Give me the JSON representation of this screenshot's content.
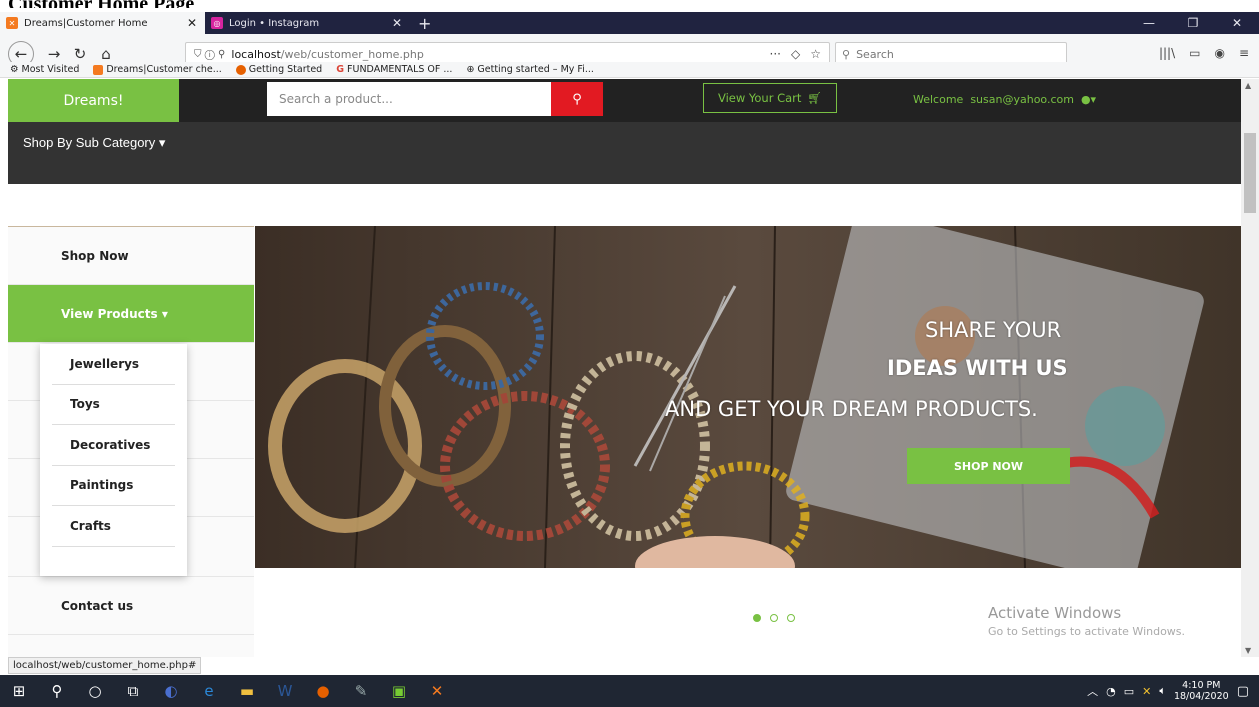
{
  "caption": "Customer Home Page",
  "browser": {
    "tabs": [
      {
        "label": "Dreams|Customer Home",
        "active": true,
        "color": "#f47a20"
      },
      {
        "label": "Login • Instagram",
        "active": false,
        "color": "#d6249f"
      }
    ],
    "url_host": "localhost",
    "url_path": "/web/customer_home.php",
    "search_placeholder": "Search",
    "bookmarks": [
      {
        "label": "Most Visited",
        "icon": "gear-icon"
      },
      {
        "label": "Dreams|Customer che...",
        "icon": "xampp-icon"
      },
      {
        "label": "Getting Started",
        "icon": "firefox-icon"
      },
      {
        "label": "FUNDAMENTALS OF ...",
        "icon": "google-icon"
      },
      {
        "label": "Getting started – My Fi...",
        "icon": "globe-icon"
      }
    ],
    "status_url": "localhost/web/customer_home.php#"
  },
  "site": {
    "logo": "Dreams!",
    "search_placeholder": "Search a product...",
    "cart_label": "View Your Cart",
    "welcome_prefix": "Welcome",
    "user_email": "susan@yahoo.com",
    "subcategory_label": "Shop By Sub Category ▾",
    "sidebar": {
      "shop_now": "Shop Now",
      "view_products": "View Products ▾",
      "contact": "Contact us"
    },
    "dropdown": [
      "Jewellerys",
      "Toys",
      "Decoratives",
      "Paintings",
      "Crafts"
    ],
    "banner": {
      "line1": "SHARE YOUR",
      "line2": "IDEAS WITH US",
      "line3": "AND GET YOUR DREAM PRODUCTS.",
      "button": "SHOP NOW"
    },
    "slides": 3,
    "active_slide": 1
  },
  "watermark": {
    "title": "Activate Windows",
    "subtitle": "Go to Settings to activate Windows."
  },
  "taskbar": {
    "time": "4:10 PM",
    "date": "18/04/2020"
  },
  "colors": {
    "accent": "#79c143",
    "search_button": "#e21a22",
    "topbar": "#222222"
  }
}
